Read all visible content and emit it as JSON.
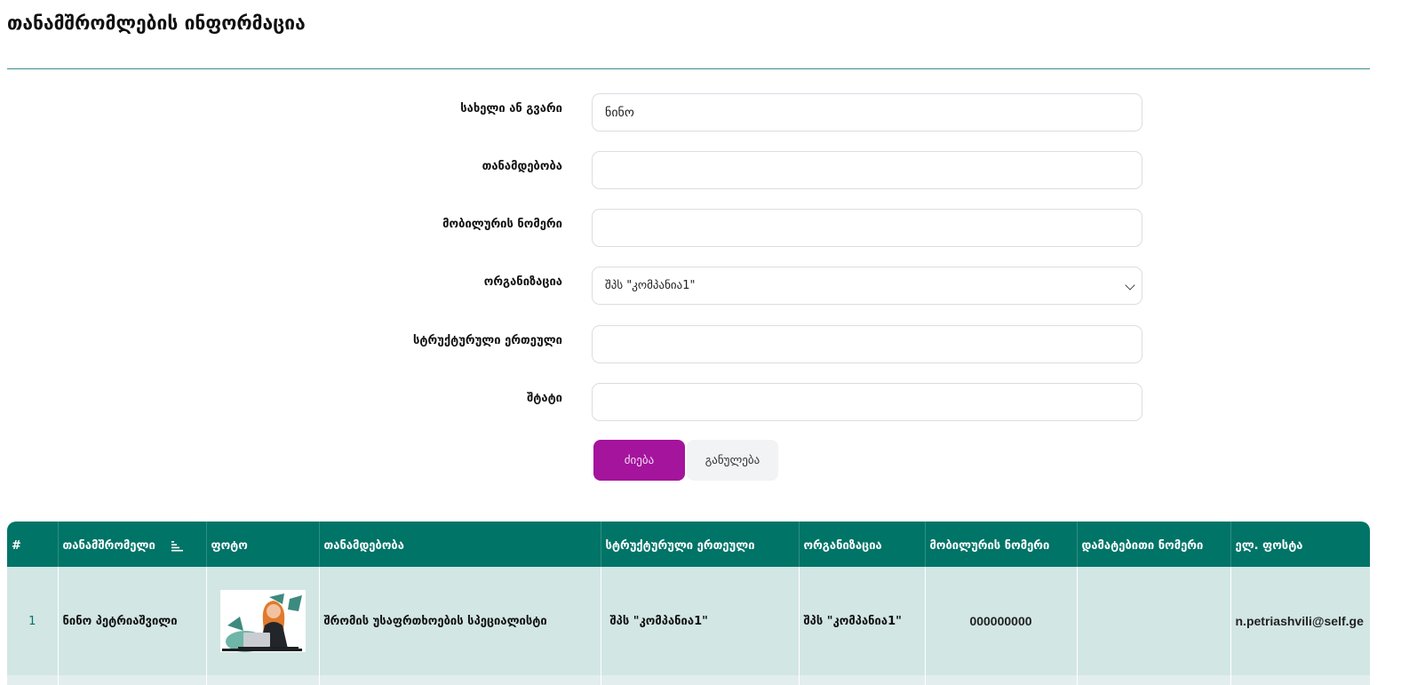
{
  "page": {
    "title": "თანამშრომლების ინფორმაცია"
  },
  "form": {
    "name_label": "სახელი ან გვარი",
    "name_value": "ნინო",
    "position_label": "თანამდებობა",
    "position_value": "",
    "mobile_label": "მობილურის ნომერი",
    "mobile_value": "",
    "organization_label": "ორგანიზაცია",
    "organization_selected": "შპს \"კომპანია1\"",
    "unit_label": "სტრუქტურული ერთეული",
    "unit_value": "",
    "staff_label": "შტატი",
    "staff_value": "",
    "search_label": "ძიება",
    "reset_label": "განულება"
  },
  "table": {
    "headers": [
      "#",
      "თანამშრომელი",
      "ფოტო",
      "თანამდებობა",
      "სტრუქტურული ერთეული",
      "ორგანიზაცია",
      "მობილურის ნომერი",
      "დამატებითი ნომერი",
      "ელ. ფოსტა"
    ],
    "rows": [
      {
        "num": "1",
        "employee": "ნინო პეტრიაშვილი",
        "position": "შრომის უსაფრთხოების სპეციალისტი",
        "unit": "შპს \"კომპანია1\"",
        "organization": "შპს \"კომპანია1\"",
        "mobile": "000000000",
        "extra": "",
        "email": "n.petriashvili@self.ge"
      }
    ]
  },
  "icons": {
    "sort": "sort-descending-icon",
    "dropdown": "chevron-down-icon",
    "photo": "employee-photo"
  },
  "colors": {
    "accent": "#a4149d",
    "header_bg": "#007467",
    "row_bg": "#d2e6e4",
    "rule": "#3a8f88"
  }
}
